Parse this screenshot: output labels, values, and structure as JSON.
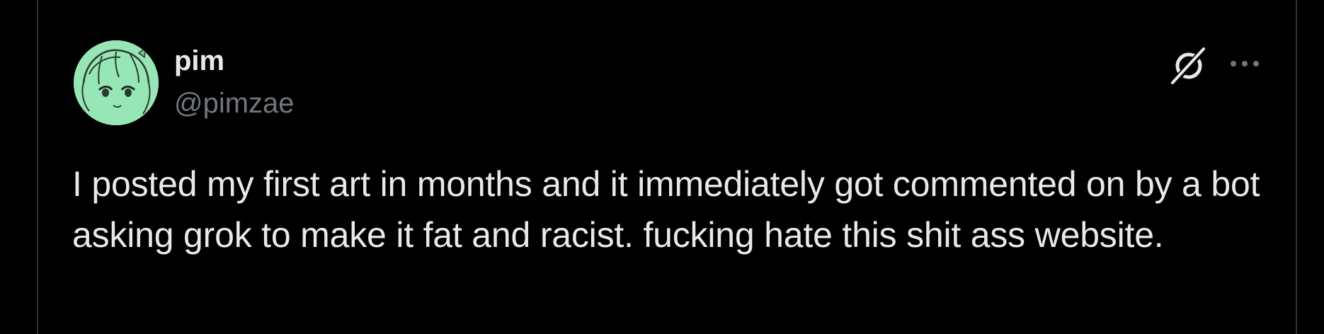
{
  "post": {
    "author": {
      "display_name": "pim",
      "handle": "@pimzae",
      "avatar_icon": "anime-character-avatar"
    },
    "actions": {
      "grok_icon": "grok-icon",
      "more_icon": "more-options-icon"
    },
    "text": "I posted my first art in months and it immediately got commented on by a bot asking grok to make it fat and racist. fucking hate this shit ass website."
  },
  "colors": {
    "background": "#000000",
    "border": "#2f3336",
    "primary_text": "#e7e9ea",
    "secondary_text": "#71767b",
    "avatar_bg": "#97e6b5"
  }
}
